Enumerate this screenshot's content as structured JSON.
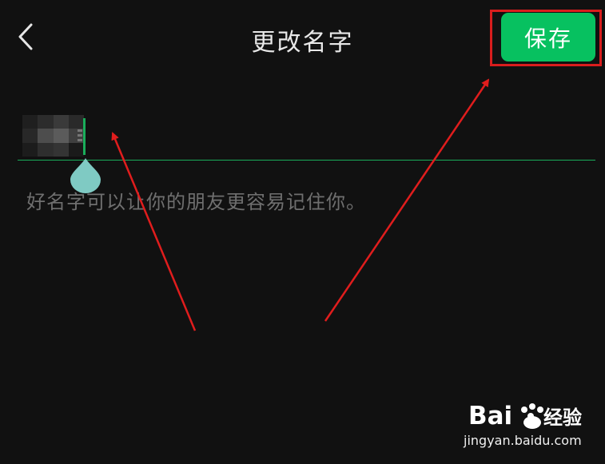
{
  "header": {
    "title": "更改名字",
    "back_icon": "chevron-left-icon",
    "save_label": "保存"
  },
  "name_field": {
    "value_masked": true,
    "hint": "好名字可以让你的朋友更容易记住你。"
  },
  "colors": {
    "background": "#111111",
    "accent_green": "#07c160",
    "underline_green": "#1aad5a",
    "handle_teal": "#7fcac3",
    "annotation_red": "#d91d1d",
    "hint_gray": "#6f6f6f"
  },
  "watermark": {
    "logo_text": "Bai du 经验",
    "site": "jingyan.baidu.com"
  }
}
